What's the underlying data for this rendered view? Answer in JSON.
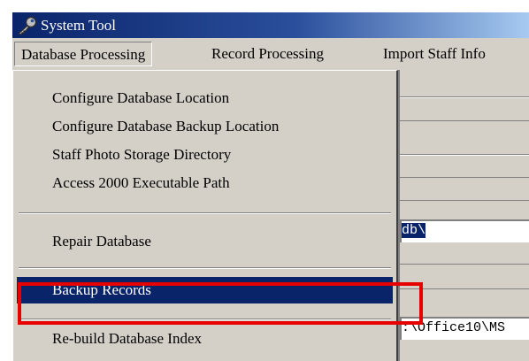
{
  "window": {
    "title": "System Tool",
    "title_icon": "key-icon"
  },
  "menubar": {
    "items": [
      "Database Processing",
      "Record Processing",
      "Import Staff Info"
    ]
  },
  "dropdown": {
    "items": [
      "Configure Database Location",
      "Configure Database Backup Location",
      "Staff Photo Storage Directory",
      "Access 2000 Executable Path",
      "Repair Database",
      "Backup Records",
      "Re-build Database Index"
    ],
    "highlighted": "Backup Records"
  },
  "background": {
    "field_1": "db\\",
    "field_2": ":\\Office10\\MS"
  },
  "annotation": {
    "color": "#e60000"
  }
}
